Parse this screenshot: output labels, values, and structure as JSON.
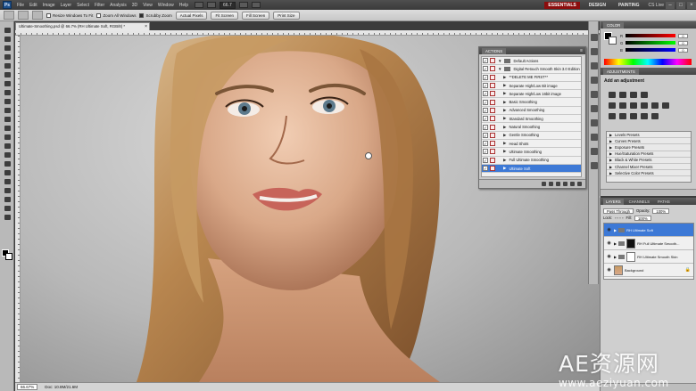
{
  "app": {
    "logo": "Ps",
    "menus": [
      "File",
      "Edit",
      "Image",
      "Layer",
      "Select",
      "Filter",
      "Analysis",
      "3D",
      "View",
      "Window",
      "Help"
    ],
    "zoom": "66.7",
    "workspaces": [
      "ESSENTIALS",
      "DESIGN",
      "PAINTING"
    ],
    "active_workspace": "ESSENTIALS",
    "cs_live": "CS Live"
  },
  "options_bar": {
    "checkbox_resize": "Resize Windows To Fit",
    "checkbox_zoom_all": "Zoom All Windows",
    "checkbox_scrubby": "Scrubby Zoom",
    "buttons": [
      "Actual Pixels",
      "Fit Screen",
      "Fill Screen",
      "Print Size"
    ]
  },
  "document": {
    "tab_title": "Ultimate-Smoothing.psd @ 66.7% (RH Ultimate Soft, RGB/8) *",
    "zoom": "66.67%",
    "doc_info": "Doc: 10.8M/21.6M"
  },
  "actions_panel": {
    "tab": "ACTIONS",
    "rows": [
      {
        "label": "Default Actions",
        "type": "folder",
        "indent": 0
      },
      {
        "label": "Digital Retouch Smooth Skin 3.0 Edition",
        "type": "folder",
        "indent": 0
      },
      {
        "label": "**DELETE ME FIRST**",
        "type": "action",
        "indent": 1
      },
      {
        "label": "Separate High/Low Bit image",
        "type": "action",
        "indent": 1
      },
      {
        "label": "Separate High/Low 16bit image",
        "type": "action",
        "indent": 1
      },
      {
        "label": "Basic Smoothing",
        "type": "action",
        "indent": 1
      },
      {
        "label": "Advanced Smoothing",
        "type": "action",
        "indent": 1
      },
      {
        "label": "Standard Smoothing",
        "type": "action",
        "indent": 1
      },
      {
        "label": "Natural Smoothing",
        "type": "action",
        "indent": 1
      },
      {
        "label": "Gentle Smoothing",
        "type": "action",
        "indent": 1
      },
      {
        "label": "Head Shots",
        "type": "action",
        "indent": 1
      },
      {
        "label": "Ultimate Smoothing",
        "type": "action",
        "indent": 1
      },
      {
        "label": "Full Ultimate Smoothing",
        "type": "action",
        "indent": 1
      },
      {
        "label": "Ultimate Soft",
        "type": "action",
        "indent": 1,
        "selected": true
      }
    ]
  },
  "color_panel": {
    "tab": "COLOR",
    "sliders": [
      {
        "label": "R",
        "value": "0"
      },
      {
        "label": "G",
        "value": "0"
      },
      {
        "label": "B",
        "value": "0"
      }
    ]
  },
  "adjustments_panel": {
    "tab": "ADJUSTMENTS",
    "title": "Add an adjustment",
    "presets": [
      "Levels Presets",
      "Curves Presets",
      "Exposure Presets",
      "Hue/Saturation Presets",
      "Black & White Presets",
      "Channel Mixer Presets",
      "Selective Color Presets"
    ]
  },
  "layers_panel": {
    "tabs": [
      "LAYERS",
      "CHANNELS",
      "PATHS"
    ],
    "blend_mode": "Pass Through",
    "opacity_label": "Opacity:",
    "opacity": "100%",
    "lock_label": "Lock:",
    "fill_label": "Fill:",
    "fill": "100%",
    "layers": [
      {
        "name": "RH Ultimate Soft",
        "selected": true,
        "type": "group"
      },
      {
        "name": "RH Full Ultimate Smooth...",
        "selected": false,
        "type": "group-mask"
      },
      {
        "name": "RH Ultimate Smooth Skin",
        "selected": false,
        "type": "group-mask"
      },
      {
        "name": "Background",
        "selected": false,
        "type": "image"
      }
    ]
  },
  "watermark": {
    "big": "AE资源网",
    "small": "www.aeziyuan.com"
  },
  "colors": {
    "accent": "#3d79d6",
    "workspace_active": "#8b0d0d"
  }
}
